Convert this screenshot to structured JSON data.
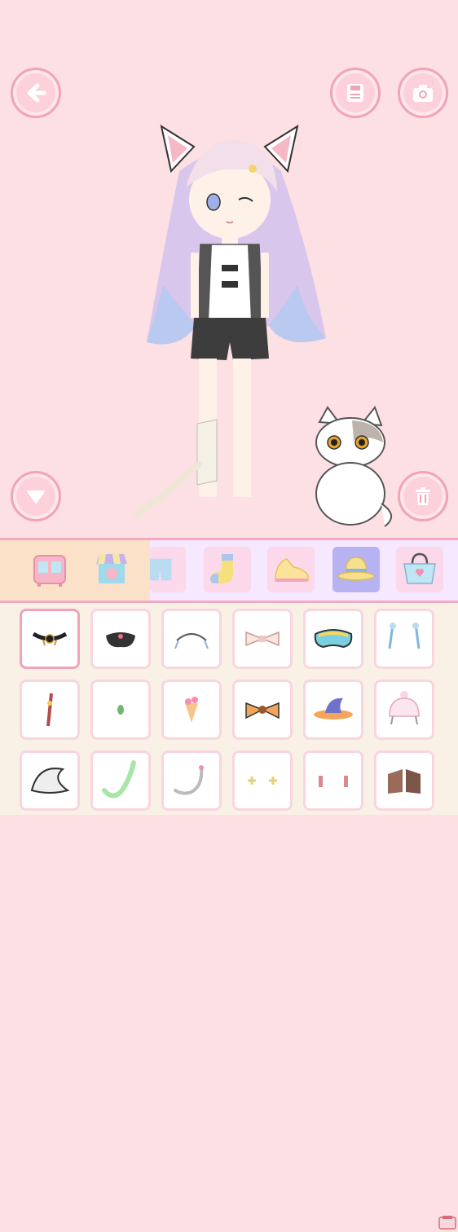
{
  "toolbar": {
    "back_icon": "arrow-left-icon",
    "save_icon": "floppy-disk-icon",
    "camera_icon": "camera-icon",
    "collapse_icon": "triangle-down-icon",
    "delete_icon": "trash-icon"
  },
  "colors": {
    "background": "#fde0e3",
    "button_fill": "#fdd1da",
    "button_border": "#f2a3b8",
    "category_bar": "#f6e8ff",
    "category_left_panel": "#fbe1c8",
    "item_grid_bg": "#f9f1e6",
    "selected_tab": "#b7b3f2"
  },
  "categories": [
    {
      "icon": "wardrobe-icon",
      "selected": false
    },
    {
      "icon": "shop-icon",
      "selected": false
    },
    {
      "icon": "shorts-icon",
      "selected": false
    },
    {
      "icon": "sock-icon",
      "selected": false
    },
    {
      "icon": "shoe-icon",
      "selected": false
    },
    {
      "icon": "hat-icon",
      "selected": true
    },
    {
      "icon": "handbag-icon",
      "selected": false
    }
  ],
  "items": [
    {
      "icon": "choker-icon",
      "selected": true
    },
    {
      "icon": "mask-icon",
      "selected": false
    },
    {
      "icon": "maid-headband-icon",
      "selected": false
    },
    {
      "icon": "ribbon-bow-icon",
      "selected": false
    },
    {
      "icon": "ski-goggles-icon",
      "selected": false
    },
    {
      "icon": "blue-earrings-icon",
      "selected": false
    },
    {
      "icon": "red-tassel-icon",
      "selected": false
    },
    {
      "icon": "green-gem-icon",
      "selected": false
    },
    {
      "icon": "fruit-pin-icon",
      "selected": false
    },
    {
      "icon": "candy-bow-icon",
      "selected": false
    },
    {
      "icon": "witch-hat-icon",
      "selected": false
    },
    {
      "icon": "beanie-icon",
      "selected": false
    },
    {
      "icon": "fur-tail-icon",
      "selected": false
    },
    {
      "icon": "green-tail-icon",
      "selected": false
    },
    {
      "icon": "white-tail-icon",
      "selected": false
    },
    {
      "icon": "cross-clips-icon",
      "selected": false
    },
    {
      "icon": "pendant-earrings-icon",
      "selected": false
    },
    {
      "icon": "wings-icon",
      "selected": false
    }
  ],
  "character": {
    "icon": "chibi-girl-icon"
  },
  "pet": {
    "icon": "cat-icon"
  }
}
